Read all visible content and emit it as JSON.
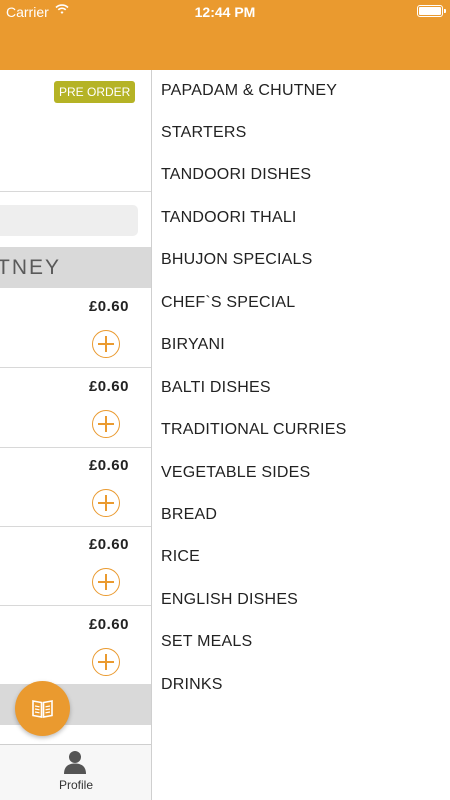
{
  "status_bar": {
    "carrier": "Carrier",
    "time": "12:44 PM"
  },
  "left_panel": {
    "preorder_label": "PRE ORDER",
    "category_header": "TNEY",
    "items": [
      {
        "price": "£0.60"
      },
      {
        "price": "£0.60"
      },
      {
        "price": "£0.60"
      },
      {
        "price": "£0.60"
      },
      {
        "price": "£0.60"
      }
    ],
    "tab_profile_label": "Profile"
  },
  "menu": {
    "items": [
      "PAPADAM & CHUTNEY",
      "STARTERS",
      "TANDOORI DISHES",
      "TANDOORI THALI",
      "BHUJON SPECIALS",
      "CHEF`S SPECIAL",
      "BIRYANI",
      "BALTI DISHES",
      "TRADITIONAL CURRIES",
      "VEGETABLE SIDES",
      "BREAD",
      "RICE",
      "ENGLISH DISHES",
      "SET MEALS",
      "DRINKS"
    ]
  },
  "colors": {
    "accent": "#ea9a2f",
    "preorder": "#b5b325",
    "category_bg": "#d9d9d9"
  },
  "icons": {
    "wifi": "wifi-icon",
    "battery": "battery-icon",
    "add": "plus-circle-icon",
    "menu_book": "book-icon",
    "profile": "person-icon"
  }
}
